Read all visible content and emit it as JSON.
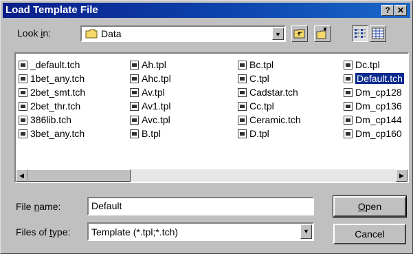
{
  "window": {
    "title": "Load Template File"
  },
  "titlebar_buttons": {
    "help": "?",
    "close": "✕"
  },
  "look_in": {
    "label_pre": "Look ",
    "label_u": "i",
    "label_post": "n:",
    "value": "Data"
  },
  "files": {
    "columns": [
      [
        "_default.tch",
        "1bet_any.tch",
        "2bet_smt.tch",
        "2bet_thr.tch",
        "386lib.tch",
        "3bet_any.tch"
      ],
      [
        "Ah.tpl",
        "Ahc.tpl",
        "Av.tpl",
        "Av1.tpl",
        "Avc.tpl",
        "B.tpl"
      ],
      [
        "Bc.tpl",
        "C.tpl",
        "Cadstar.tch",
        "Cc.tpl",
        "Ceramic.tch",
        "D.tpl"
      ],
      [
        "Dc.tpl",
        "Default.tch",
        "Dm_cp128",
        "Dm_cp136",
        "Dm_cp144",
        "Dm_cp160"
      ]
    ],
    "selected": "Default.tch"
  },
  "file_name": {
    "label_pre": "File ",
    "label_u": "n",
    "label_post": "ame:",
    "value": "Default"
  },
  "files_of_type": {
    "label_pre": "Files of ",
    "label_u": "t",
    "label_post": "ype:",
    "value": "Template (*.tpl;*.tch)"
  },
  "buttons": {
    "open_u": "O",
    "open_rest": "pen",
    "cancel": "Cancel"
  }
}
